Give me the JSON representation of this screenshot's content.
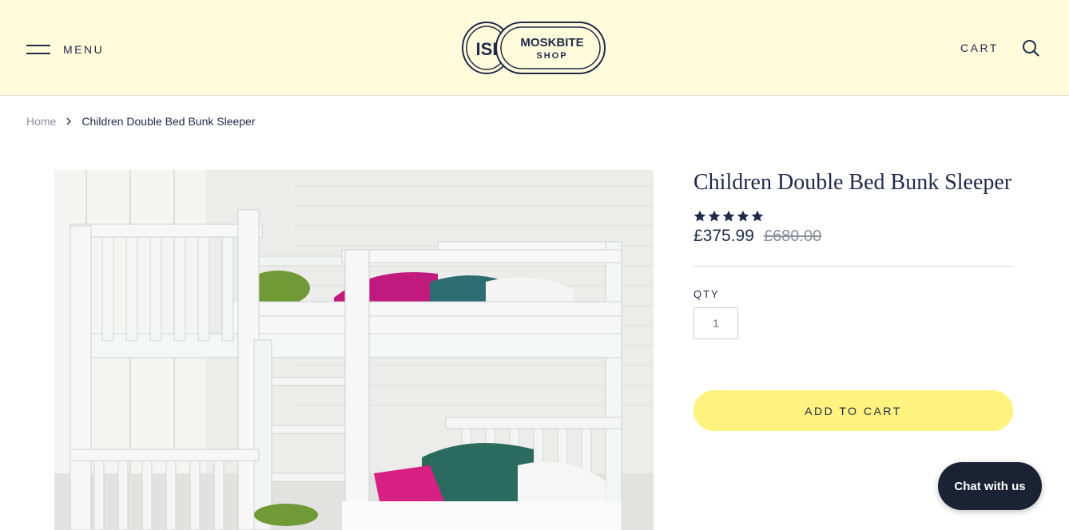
{
  "header": {
    "menu_label": "MENU",
    "logo": {
      "monogram": "ISI",
      "line1": "MOSKBITE",
      "line2": "SHOP"
    },
    "cart_label": "CART"
  },
  "breadcrumb": {
    "home": "Home",
    "current": "Children Double Bed Bunk Sleeper"
  },
  "product": {
    "title": "Children Double Bed Bunk Sleeper",
    "rating_stars": 5,
    "price": "£375.99",
    "compare_price": "£680.00",
    "qty_label": "QTY",
    "qty_value": "1",
    "add_to_cart_label": "ADD TO CART"
  },
  "chat": {
    "label": "Chat with us"
  },
  "colors": {
    "header_bg": "#fffbdb",
    "navy": "#1f2a4a",
    "button_yellow": "#fff27e",
    "chat_bg": "#1a2233"
  }
}
